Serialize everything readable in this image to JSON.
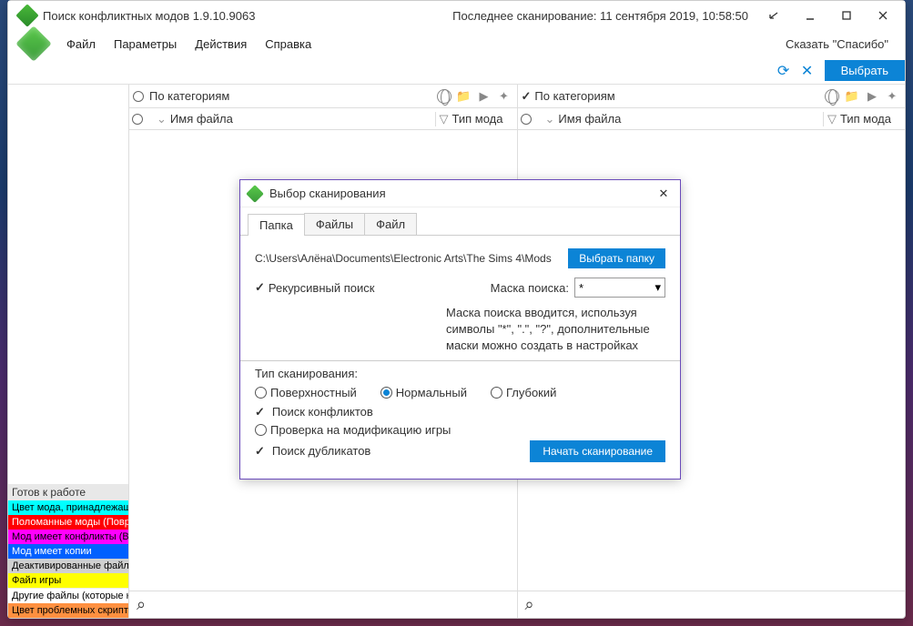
{
  "title": "Поиск конфликтных модов 1.9.10.9063",
  "last_scan": "Последнее сканирование: 11 сентября 2019, 10:58:50",
  "menu": {
    "file": "Файл",
    "params": "Параметры",
    "actions": "Действия",
    "help": "Справка"
  },
  "thanks": "Сказать \"Спасибо\"",
  "toolbar": {
    "select": "Выбрать"
  },
  "pane": {
    "by_category": "По категориям",
    "col_name": "Имя файла",
    "col_type": "Тип мода"
  },
  "status": "Готов к работе",
  "legend": {
    "l1": "Цвет мода, принадлежащег",
    "l2": "Поломанные моды (Повре",
    "l3": "Мод имеет конфликты (Вкл",
    "l4": "Мод имеет копии",
    "l5": "Деактивированные файлы",
    "l6": "Файл игры",
    "l7": "Другие файлы (которые не",
    "l8": "Цвет проблемных скриптов"
  },
  "dialog": {
    "title": "Выбор сканирования",
    "tabs": {
      "folder": "Папка",
      "files": "Файлы",
      "file": "Файл"
    },
    "path": "C:\\Users\\Алёна\\Documents\\Electronic Arts\\The Sims 4\\Mods",
    "choose_folder": "Выбрать папку",
    "recursive": "Рекурсивный поиск",
    "mask_label": "Маска поиска:",
    "mask_value": "*",
    "mask_note1": "Маска поиска вводится, используя",
    "mask_note2": "символы \"*\", \".\", \"?\", дополнительные",
    "mask_note3": "маски можно создать в настройках",
    "scan_type_label": "Тип сканирования:",
    "surface": "Поверхностный",
    "normal": "Нормальный",
    "deep": "Глубокий",
    "conflicts": "Поиск конфликтов",
    "game_mod": "Проверка на модификацию игры",
    "duplicates": "Поиск дубликатов",
    "start": "Начать сканирование"
  }
}
